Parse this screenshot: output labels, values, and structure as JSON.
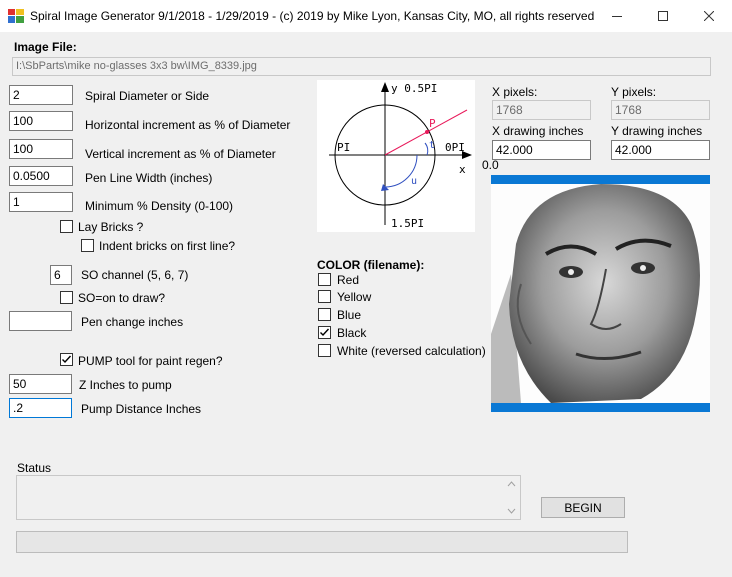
{
  "window": {
    "title": "Spiral Image Generator 9/1/2018 - 1/29/2019 - (c) 2019 by Mike Lyon, Kansas City, MO, all rights reserved"
  },
  "image_file": {
    "label": "Image File:",
    "path": "I:\\SbParts\\mike no-glasses 3x3 bw\\IMG_8339.jpg"
  },
  "params": [
    {
      "value": "2",
      "label": "Spiral Diameter or Side"
    },
    {
      "value": "100",
      "label": "Horizontal increment as % of Diameter"
    },
    {
      "value": "100",
      "label": "Vertical increment as % of Diameter"
    },
    {
      "value": "0.0500",
      "label": "Pen Line Width (inches)"
    },
    {
      "value": "1",
      "label": "Minimum % Density (0-100)"
    }
  ],
  "bricks": {
    "lay_label": "Lay Bricks ?",
    "lay_checked": false,
    "indent_label": "Indent bricks on first line?",
    "indent_checked": false
  },
  "so": {
    "channel_value": "6",
    "channel_label": "SO channel (5, 6, 7)",
    "on_label": "SO=on to draw?",
    "on_checked": false
  },
  "pen_change": {
    "value": "",
    "label": "Pen change inches"
  },
  "pump": {
    "label": "PUMP tool for paint regen?",
    "checked": true,
    "z_value": "50",
    "z_label": "Z Inches to pump",
    "dist_value": ".2",
    "dist_label": "Pump Distance Inches"
  },
  "diagram": {
    "top_label": "y 0.5PI",
    "left_label": "PI",
    "right_label": "0PI",
    "bottom_label": "1.5PI",
    "x_label": "x",
    "p_label": "P",
    "t_label": "t",
    "u_label": "u",
    "origin_label": "0.0"
  },
  "pixels": {
    "x_label": "X pixels:",
    "x_value": "1768",
    "y_label": "Y pixels:",
    "y_value": "1768",
    "xin_label": "X drawing inches",
    "xin_value": "42.000",
    "yin_label": "Y drawing inches",
    "yin_value": "42.000"
  },
  "color": {
    "title": "COLOR (filename):",
    "options": [
      {
        "label": "Red",
        "checked": false
      },
      {
        "label": "Yellow",
        "checked": false
      },
      {
        "label": "Blue",
        "checked": false
      },
      {
        "label": "Black",
        "checked": true
      },
      {
        "label": "White (reversed calculation)",
        "checked": false
      }
    ]
  },
  "status": {
    "label": "Status",
    "text": ""
  },
  "begin": {
    "label": "BEGIN"
  },
  "colors": {
    "accent_bar": "#0a78d4",
    "diagram_line": "#e8195a",
    "arc": "#3050c0"
  }
}
